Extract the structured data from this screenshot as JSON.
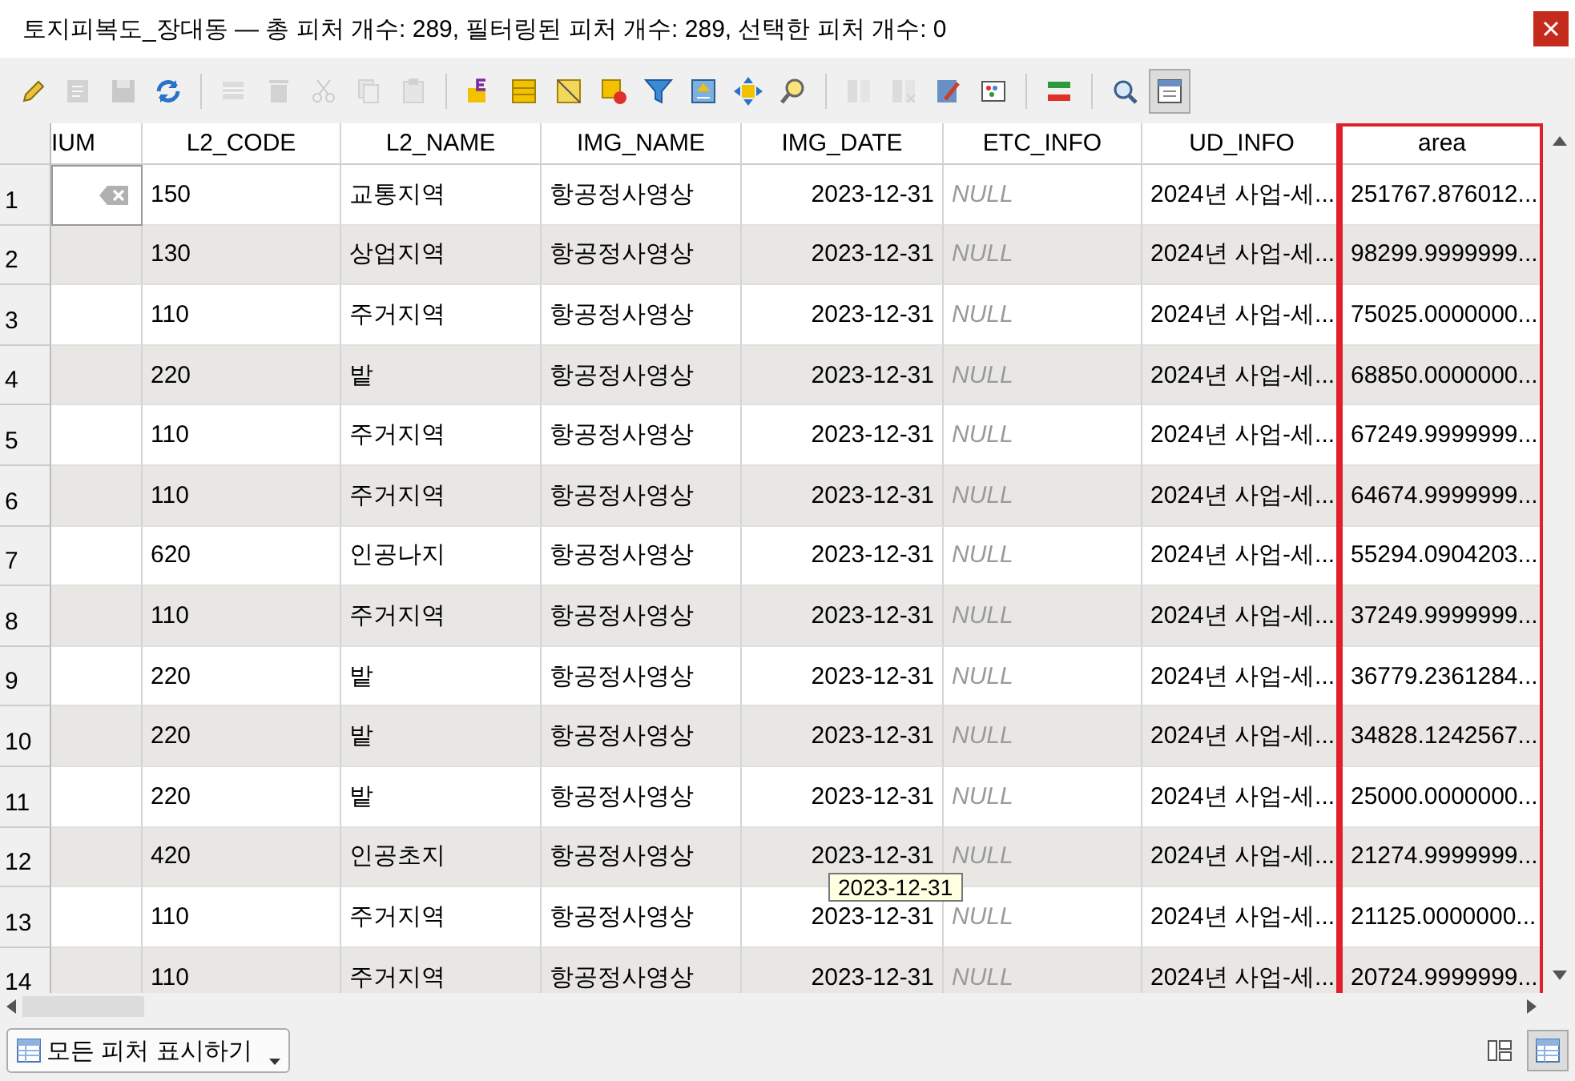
{
  "window": {
    "title": "토지피복도_장대동 — 총 피처 개수: 289, 필터링된 피처 개수: 289, 선택한 피처 개수: 0"
  },
  "toolbar": [
    {
      "kind": "pencil",
      "disabled": false
    },
    {
      "kind": "multiedit",
      "disabled": true
    },
    {
      "kind": "save",
      "disabled": true
    },
    {
      "kind": "refresh",
      "disabled": false
    },
    {
      "kind": "addrow",
      "disabled": true,
      "group_start": true
    },
    {
      "kind": "trash",
      "disabled": true
    },
    {
      "kind": "cut",
      "disabled": true
    },
    {
      "kind": "copy",
      "disabled": true
    },
    {
      "kind": "paste",
      "disabled": true
    },
    {
      "kind": "expr",
      "disabled": false,
      "group_start": true
    },
    {
      "kind": "selectall",
      "disabled": false
    },
    {
      "kind": "invert",
      "disabled": false
    },
    {
      "kind": "deselect",
      "disabled": false
    },
    {
      "kind": "filter",
      "disabled": false
    },
    {
      "kind": "movetop",
      "disabled": false
    },
    {
      "kind": "pan",
      "disabled": false
    },
    {
      "kind": "zoom",
      "disabled": false
    },
    {
      "kind": "addcol",
      "disabled": true,
      "group_start": true
    },
    {
      "kind": "delcol",
      "disabled": true
    },
    {
      "kind": "calc",
      "disabled": false
    },
    {
      "kind": "cond",
      "disabled": false
    },
    {
      "kind": "actions",
      "disabled": false,
      "group_start": true
    },
    {
      "kind": "search",
      "disabled": false,
      "group_start": true
    },
    {
      "kind": "dock",
      "disabled": false,
      "selected": true
    }
  ],
  "table": {
    "columns": [
      {
        "label": "IUM",
        "highlighted": false
      },
      {
        "label": "L2_CODE",
        "highlighted": false
      },
      {
        "label": "L2_NAME",
        "highlighted": false
      },
      {
        "label": "IMG_NAME",
        "highlighted": false
      },
      {
        "label": "IMG_DATE",
        "highlighted": false
      },
      {
        "label": "ETC_INFO",
        "highlighted": false
      },
      {
        "label": "UD_INFO",
        "highlighted": false
      },
      {
        "label": "area",
        "highlighted": true
      }
    ],
    "rows": [
      {
        "number": "1",
        "editing": true,
        "cells": [
          "",
          "150",
          "교통지역",
          "항공정사영상",
          "2023-12-31",
          "NULL",
          "2024년 사업-세...",
          "251767.876012..."
        ]
      },
      {
        "number": "2",
        "cells": [
          "",
          "130",
          "상업지역",
          "항공정사영상",
          "2023-12-31",
          "NULL",
          "2024년 사업-세...",
          "98299.9999999..."
        ]
      },
      {
        "number": "3",
        "cells": [
          "",
          "110",
          "주거지역",
          "항공정사영상",
          "2023-12-31",
          "NULL",
          "2024년 사업-세...",
          "75025.0000000..."
        ]
      },
      {
        "number": "4",
        "cells": [
          "",
          "220",
          "밭",
          "항공정사영상",
          "2023-12-31",
          "NULL",
          "2024년 사업-세...",
          "68850.0000000..."
        ]
      },
      {
        "number": "5",
        "cells": [
          "",
          "110",
          "주거지역",
          "항공정사영상",
          "2023-12-31",
          "NULL",
          "2024년 사업-세...",
          "67249.9999999..."
        ]
      },
      {
        "number": "6",
        "cells": [
          "",
          "110",
          "주거지역",
          "항공정사영상",
          "2023-12-31",
          "NULL",
          "2024년 사업-세...",
          "64674.9999999..."
        ]
      },
      {
        "number": "7",
        "cells": [
          "",
          "620",
          "인공나지",
          "항공정사영상",
          "2023-12-31",
          "NULL",
          "2024년 사업-세...",
          "55294.0904203..."
        ]
      },
      {
        "number": "8",
        "cells": [
          "",
          "110",
          "주거지역",
          "항공정사영상",
          "2023-12-31",
          "NULL",
          "2024년 사업-세...",
          "37249.9999999..."
        ]
      },
      {
        "number": "9",
        "cells": [
          "",
          "220",
          "밭",
          "항공정사영상",
          "2023-12-31",
          "NULL",
          "2024년 사업-세...",
          "36779.2361284..."
        ]
      },
      {
        "number": "10",
        "cells": [
          "",
          "220",
          "밭",
          "항공정사영상",
          "2023-12-31",
          "NULL",
          "2024년 사업-세...",
          "34828.1242567..."
        ]
      },
      {
        "number": "11",
        "cells": [
          "",
          "220",
          "밭",
          "항공정사영상",
          "2023-12-31",
          "NULL",
          "2024년 사업-세...",
          "25000.0000000..."
        ]
      },
      {
        "number": "12",
        "tooltip": "2023-12-31",
        "cells": [
          "",
          "420",
          "인공초지",
          "항공정사영상",
          "2023-12-31",
          "NULL",
          "2024년 사업-세...",
          "21274.9999999..."
        ]
      },
      {
        "number": "13",
        "cells": [
          "",
          "110",
          "주거지역",
          "항공정사영상",
          "2023-12-31",
          "NULL",
          "2024년 사업-세...",
          "21125.0000000..."
        ]
      },
      {
        "number": "14",
        "cells": [
          "",
          "110",
          "주거지역",
          "항공정사영상",
          "2023-12-31",
          "NULL",
          "2024년 사업-세...",
          "20724.9999999..."
        ]
      }
    ]
  },
  "bottom_bar": {
    "filter_button": "모든 피처 표시하기",
    "views": [
      {
        "kind": "form",
        "selected": false
      },
      {
        "kind": "table",
        "selected": true
      }
    ]
  }
}
